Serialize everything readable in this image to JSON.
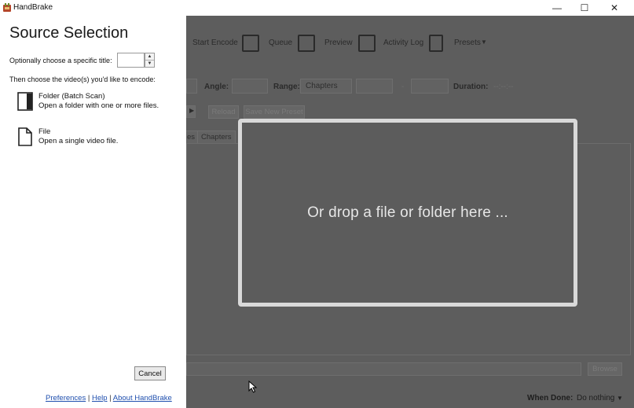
{
  "window": {
    "title": "HandBrake",
    "minimize_glyph": "—",
    "maximize_glyph": "☐",
    "close_glyph": "✕"
  },
  "toolbar": {
    "start_encode": "Start Encode",
    "queue": "Queue",
    "preview": "Preview",
    "activity_log": "Activity Log",
    "presets": "Presets"
  },
  "source_row": {
    "angle_label": "Angle:",
    "range_label": "Range:",
    "range_value": "Chapters",
    "range_sep": "-",
    "duration_label": "Duration:",
    "duration_value": "--:--:--"
  },
  "preset_row": {
    "reload": "Reload",
    "save_new_preset": "Save New Preset"
  },
  "tabs": {
    "partial": "es",
    "chapters": "Chapters"
  },
  "dropzone": {
    "text": "Or drop a file or folder here ..."
  },
  "bottom": {
    "browse": "Browse",
    "when_done_label": "When Done:",
    "when_done_value": "Do nothing"
  },
  "panel": {
    "title": "Source Selection",
    "title_label": "Optionally choose a specific title:",
    "title_value": "",
    "choose_label": "Then choose the video(s) you'd like to encode:",
    "folder_name": "Folder (Batch Scan)",
    "folder_desc": "Open a folder with one or more files.",
    "file_name": "File",
    "file_desc": "Open a single video file.",
    "cancel": "Cancel",
    "link_preferences": "Preferences",
    "link_help": "Help",
    "link_about": "About HandBrake",
    "link_sep": "|"
  },
  "colors": {
    "overlay": "#5d5d5d",
    "panel_bg": "#ffffff",
    "link": "#1f4fae",
    "dropzone_border": "#d9d9d9"
  }
}
